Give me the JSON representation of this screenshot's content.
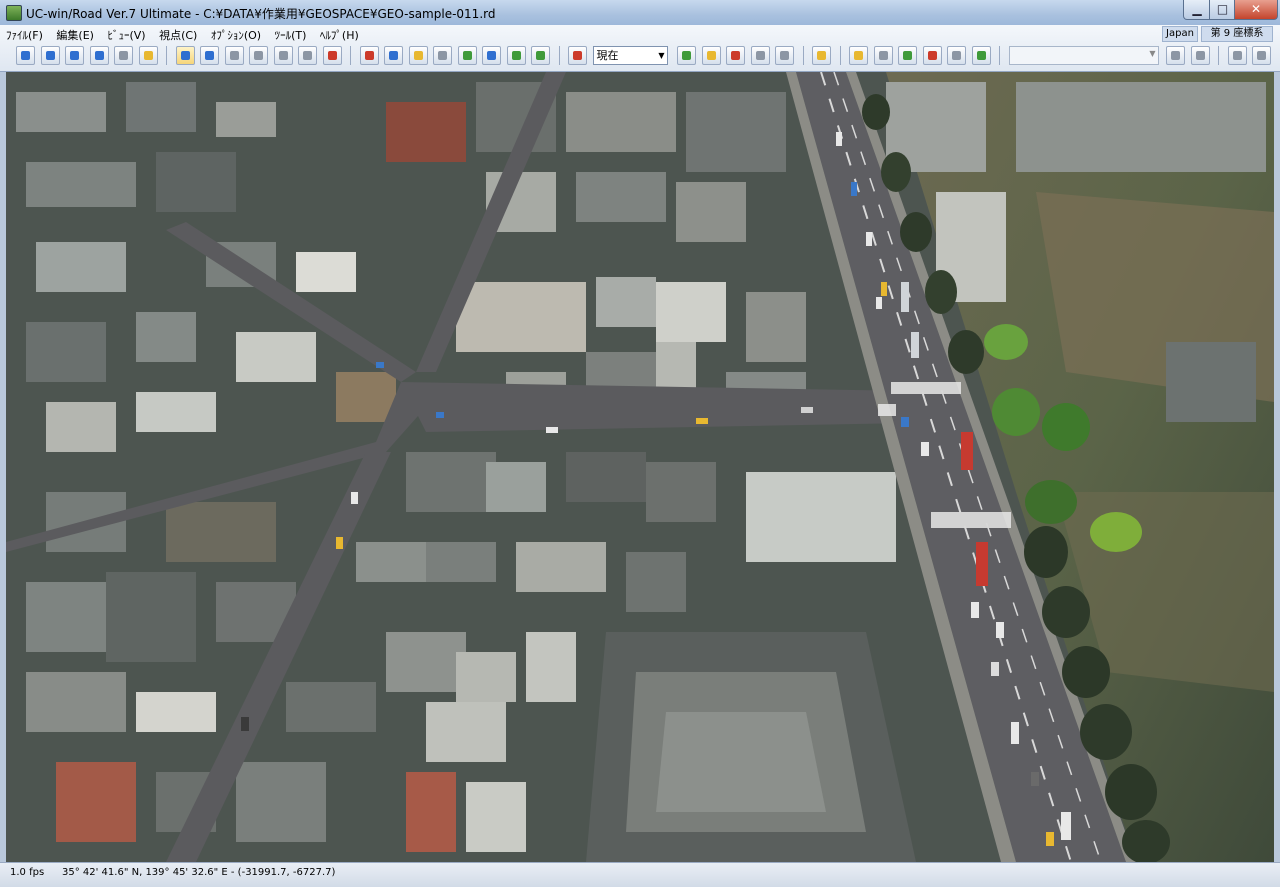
{
  "window": {
    "title": "UC-win/Road Ver.7 Ultimate - C:¥DATA¥作業用¥GEOSPACE¥GEO-sample-011.rd",
    "minimize": "▁",
    "maximize": "□",
    "close": "✕"
  },
  "menu": {
    "items": [
      {
        "label": "ﾌｧｲﾙ(F)"
      },
      {
        "label": "編集(E)"
      },
      {
        "label": "ﾋﾞｭｰ(V)"
      },
      {
        "label": "視点(C)"
      },
      {
        "label": "ｵﾌﾟｼｮﾝ(O)"
      },
      {
        "label": "ﾂｰﾙ(T)"
      },
      {
        "label": "ﾍﾙﾌﾟ(H)"
      }
    ]
  },
  "toolbar": {
    "time_select_value": "現在",
    "region_label": "Japan",
    "coordinate_system_label": "第 9 座標系",
    "colors": {
      "blue": "#2f6fd0",
      "green": "#3f9a3a",
      "red": "#cc3a2a",
      "yellow": "#e8b830",
      "gray": "#8c96a4"
    }
  },
  "status": {
    "fps": "1.0 fps",
    "coordinates": "35°  42' 41.6\" N, 139°  45' 32.6\" E  -  (-31991.7, -6727.7)"
  }
}
